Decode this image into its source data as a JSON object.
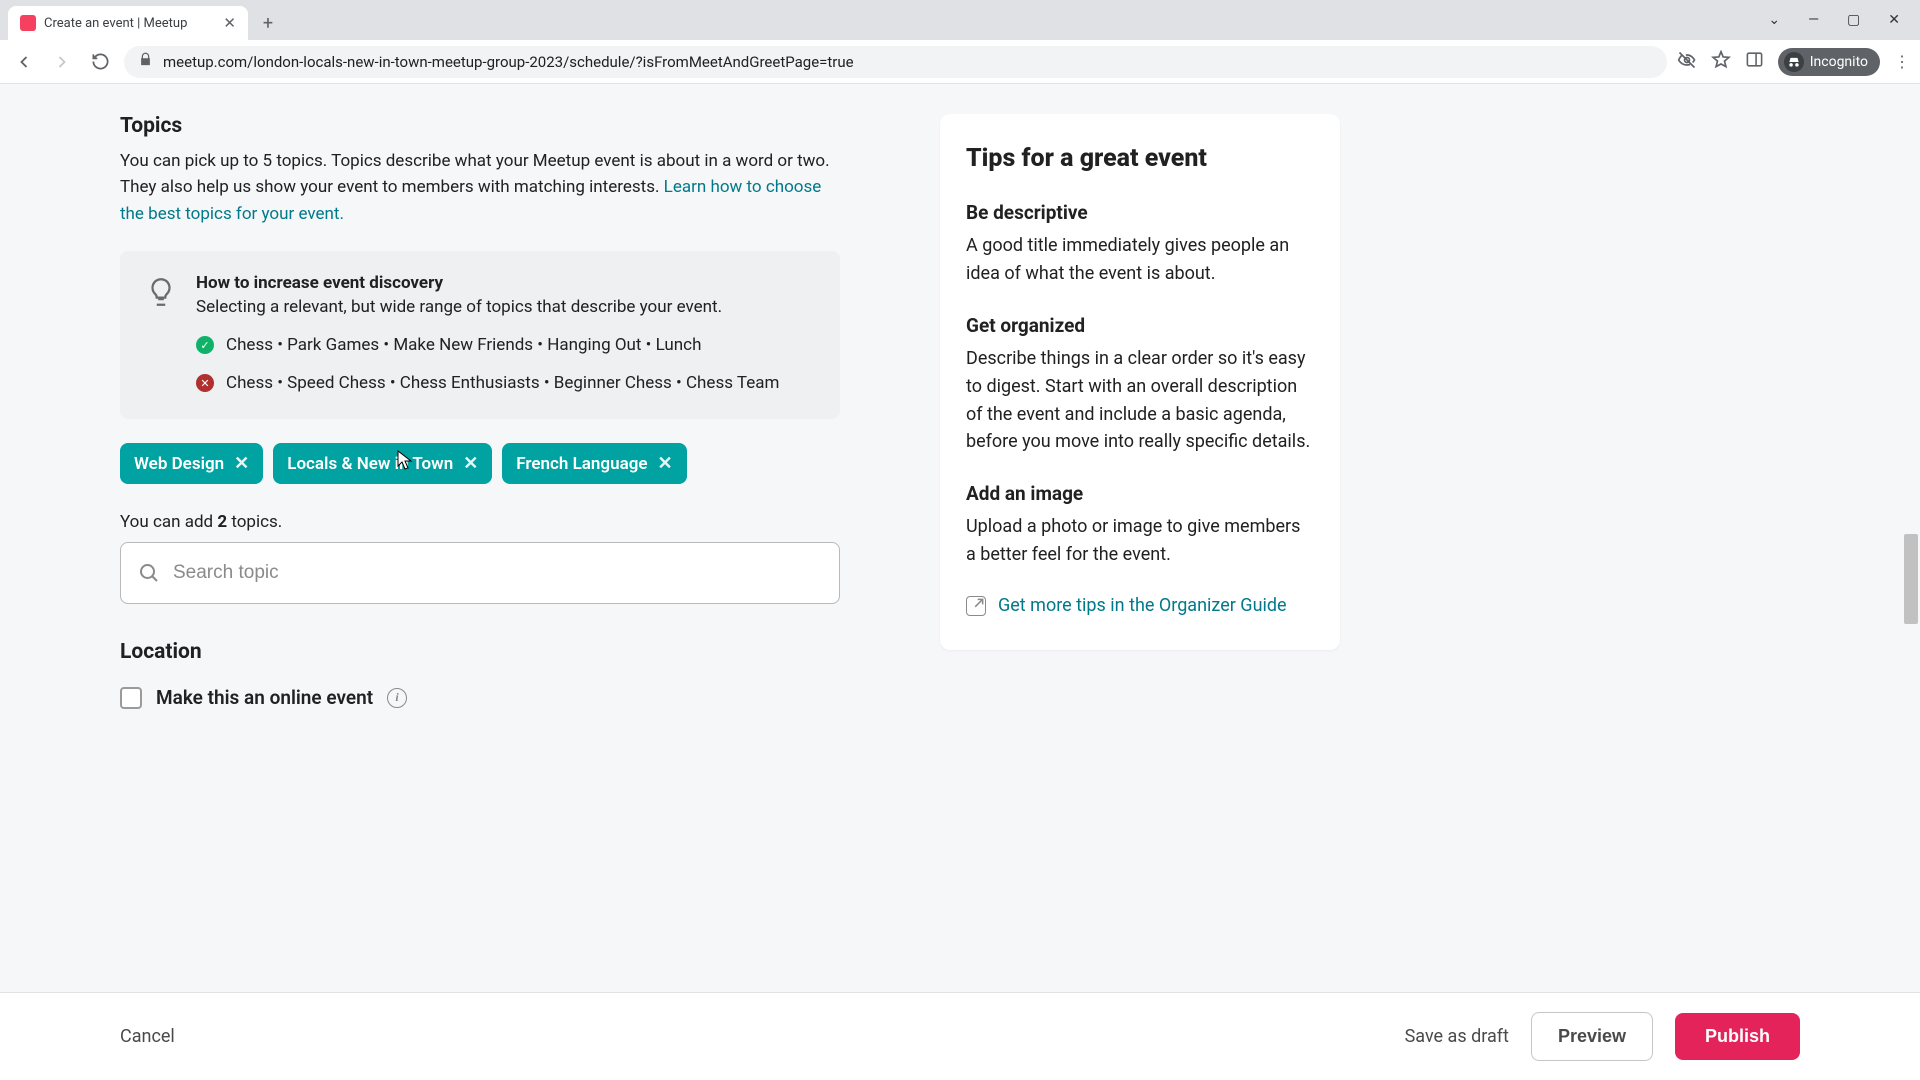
{
  "browser": {
    "tab_title": "Create an event | Meetup",
    "url": "meetup.com/london-locals-new-in-town-meetup-group-2023/schedule/?isFromMeetAndGreetPage=true",
    "incognito_label": "Incognito"
  },
  "topics": {
    "heading": "Topics",
    "description_prefix": "You can pick up to 5 topics. Topics describe what your Meetup event is about in a word or two. They also help us show your event to members with matching interests. ",
    "learn_link": "Learn how to choose the best topics for your event.",
    "tip_title": "How to increase event discovery",
    "tip_sub": "Selecting a relevant, but wide range of topics that describe your event.",
    "good_example": "Chess • Park Games • Make New Friends • Hanging Out • Lunch",
    "bad_example": "Chess • Speed Chess • Chess Enthusiasts • Beginner Chess • Chess Team",
    "selected": [
      "Web Design",
      "Locals & New in Town",
      "French Language"
    ],
    "add_count_prefix": "You can add ",
    "add_count_num": "2",
    "add_count_suffix": " topics.",
    "search_placeholder": "Search topic"
  },
  "location": {
    "heading": "Location",
    "online_label": "Make this an online event"
  },
  "sidebar": {
    "title": "Tips for a great event",
    "tips": [
      {
        "heading": "Be descriptive",
        "body": "A good title immediately gives people an idea of what the event is about."
      },
      {
        "heading": "Get organized",
        "body": "Describe things in a clear order so it's easy to digest. Start with an overall description of the event and include a basic agenda, before you move into really specific details."
      },
      {
        "heading": "Add an image",
        "body": "Upload a photo or image to give members a better feel for the event."
      }
    ],
    "guide_link": "Get more tips in the Organizer Guide"
  },
  "footer": {
    "cancel": "Cancel",
    "save_draft": "Save as draft",
    "preview": "Preview",
    "publish": "Publish"
  }
}
